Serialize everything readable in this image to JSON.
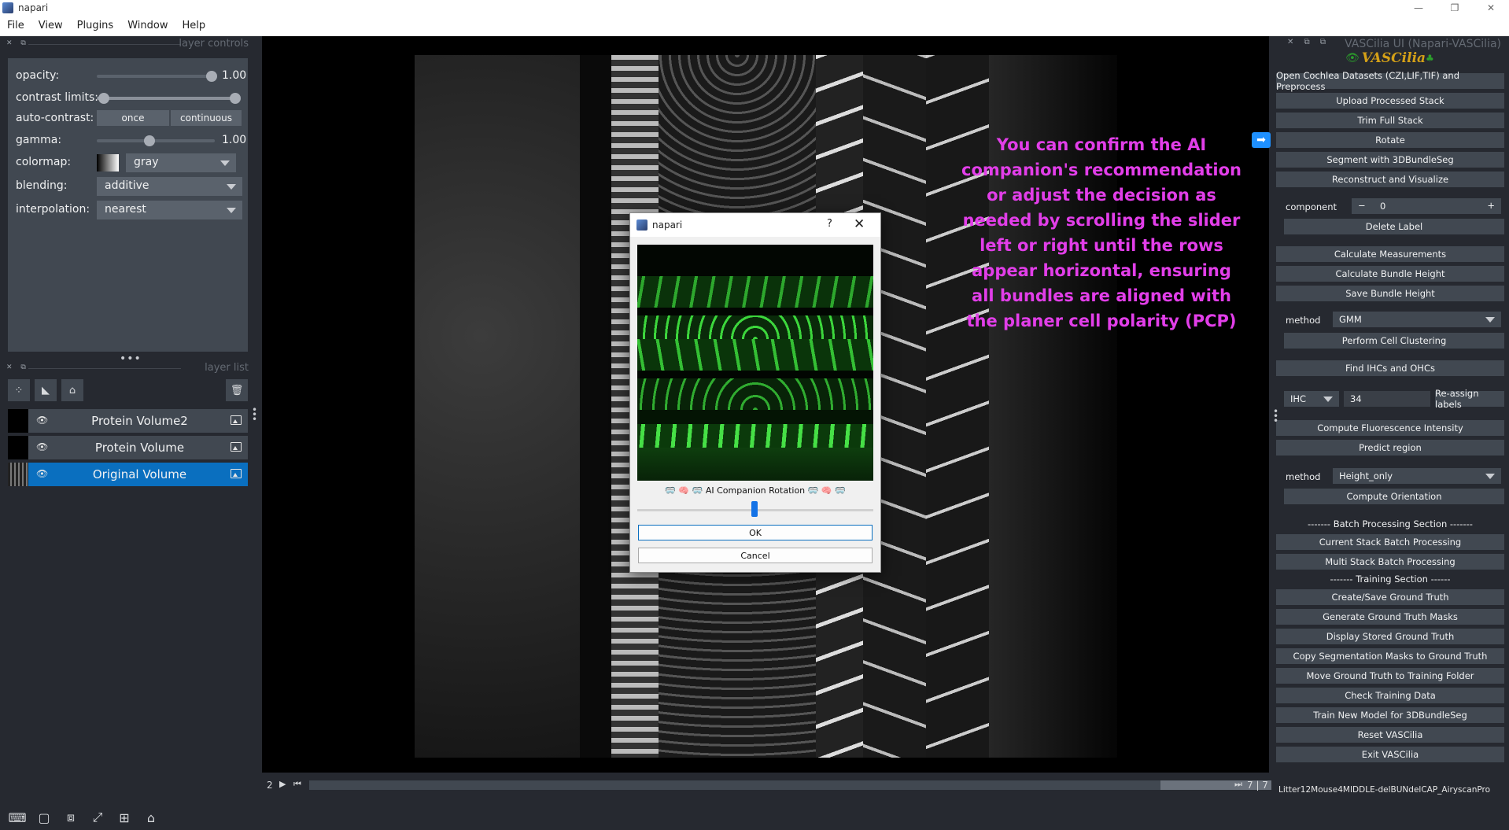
{
  "window": {
    "title": "napari",
    "controls": [
      "—",
      "❐",
      "✕"
    ]
  },
  "menu": [
    "File",
    "View",
    "Plugins",
    "Window",
    "Help"
  ],
  "layer_controls": {
    "title": "layer controls",
    "opacity": {
      "label": "opacity:",
      "value": "1.00",
      "level": 1.0
    },
    "contrast_limits": {
      "label": "contrast limits:"
    },
    "auto_contrast": {
      "label": "auto-contrast:",
      "once": "once",
      "continuous": "continuous"
    },
    "gamma": {
      "label": "gamma:",
      "value": "1.00"
    },
    "colormap": {
      "label": "colormap:",
      "value": "gray"
    },
    "blending": {
      "label": "blending:",
      "value": "additive"
    },
    "interpolation": {
      "label": "interpolation:",
      "value": "nearest"
    }
  },
  "layer_list": {
    "title": "layer list",
    "layers": [
      {
        "name": "Protein Volume2",
        "selected": false
      },
      {
        "name": "Protein Volume",
        "selected": false
      },
      {
        "name": "Original Volume",
        "selected": true
      }
    ]
  },
  "annotation": "You can confirm the AI companion's recommendation or adjust the decision as needed by scrolling the slider left or right until the rows appear horizontal, ensuring all bundles are aligned with the planer cell polarity (PCP)",
  "dims": {
    "current": "2",
    "counter": "7 | 7"
  },
  "dialog": {
    "title": "napari",
    "help": "?",
    "close": "✕",
    "caption": "🥽 🧠 🥽 AI Companion Rotation 🥽 🧠 🥽",
    "ok": "OK",
    "cancel": "Cancel"
  },
  "right_panel": {
    "dock_title": "VASCilia UI (Napari-VASCilia)",
    "logo_text": "VASCilia",
    "buttons": {
      "open": "Open Cochlea Datasets (CZI,LIF,TIF) and Preprocess",
      "upload": "Upload Processed Stack",
      "trim": "Trim Full Stack",
      "rotate": "Rotate",
      "segment": "Segment with 3DBundleSeg",
      "reconstruct": "Reconstruct and Visualize",
      "delete_label": "Delete Label",
      "calc_measure": "Calculate Measurements",
      "calc_height": "Calculate Bundle Height",
      "save_height": "Save Bundle Height",
      "cluster": "Perform Cell Clustering",
      "find_ihc": "Find IHCs and OHCs",
      "reassign": "Re-assign labels",
      "fluor": "Compute Fluorescence Intensity",
      "predict": "Predict region",
      "orientation": "Compute Orientation",
      "current_batch": "Current Stack Batch Processing",
      "multi_batch": "Multi Stack Batch Processing",
      "create_gt": "Create/Save Ground Truth",
      "gen_gt": "Generate Ground Truth Masks",
      "display_gt": "Display Stored Ground Truth",
      "copy_seg": "Copy Segmentation Masks to Ground Truth",
      "move_gt": "Move Ground Truth to Training Folder",
      "check_train": "Check Training Data",
      "train_new": "Train New Model for 3DBundleSeg",
      "reset": "Reset VASCilia",
      "exit": "Exit VASCilia"
    },
    "component": {
      "label": "component",
      "minus": "−",
      "value": "0",
      "plus": "+"
    },
    "method1": {
      "label": "method",
      "value": "GMM"
    },
    "ihc": {
      "value": "IHC",
      "number": "34"
    },
    "method2": {
      "label": "method",
      "value": "Height_only"
    },
    "batch_section": "------- Batch Processing Section -------",
    "training_section": "------- Training Section ------",
    "status": "Litter12Mouse4MIDDLE-delBUNdelCAP_AiryscanPro"
  }
}
